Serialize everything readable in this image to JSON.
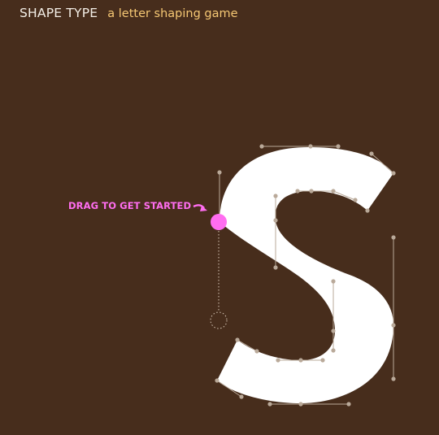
{
  "app": {
    "title": "SHAPE TYPE",
    "subtitle": "a letter shaping game"
  },
  "hint": {
    "label": "DRAG TO GET STARTED",
    "color": "#ff6df0"
  },
  "level": {
    "letter": "S"
  },
  "colors": {
    "background": "#472d1c",
    "letter_fill": "#ffffff",
    "handle": "#b9a999",
    "active_handle": "#ff6df0",
    "title": "#f3eee6",
    "subtitle": "#f6c874"
  }
}
